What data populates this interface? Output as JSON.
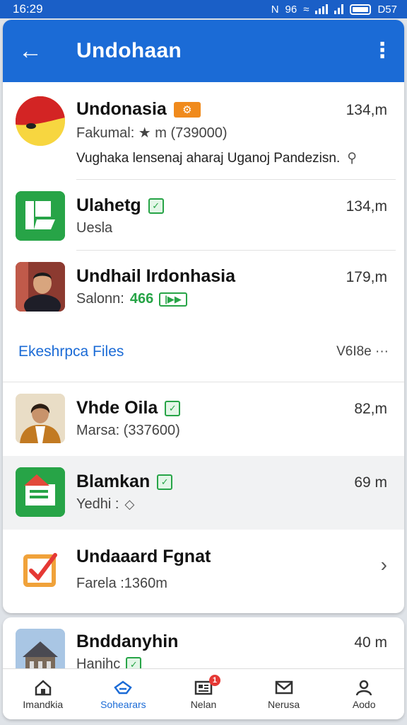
{
  "status_bar": {
    "time": "16:29",
    "network": "96",
    "battery": "D57"
  },
  "app_bar": {
    "title": "Undohaan",
    "back_icon": "arrow-left-icon",
    "menu_icon": "more-vert-icon"
  },
  "chats": [
    {
      "name": "Undonasia",
      "time": "134,m",
      "subtitle": "Fakumal: ★ m (739000)",
      "message": "Vughaka lensenaj aharaj Uganoj Pandezisn."
    },
    {
      "name": "Ulahetg",
      "time": "134,m",
      "subtitle": "Uesla"
    },
    {
      "name": "Undhail Irdonhasia",
      "time": "179,m",
      "subtitle": "Salonn:",
      "highlight": "466"
    }
  ],
  "section": {
    "title": "Ekeshrpca Files",
    "action": "V6I8e ···"
  },
  "files": [
    {
      "name": "Vhde Oila",
      "time": "82,m",
      "subtitle": "Marsa: (337600)"
    },
    {
      "name": "Blamkan",
      "time": "69 m",
      "subtitle": "Yedhi :"
    },
    {
      "name": "Undaaard Fgnat",
      "subtitle": "Farela :1360m"
    }
  ],
  "bottom_item": {
    "name": "Bnddanyhin",
    "time": "40 m",
    "subtitle": "Hanihc"
  },
  "bottom_nav": [
    {
      "label": "Imandkia",
      "icon": "home-icon"
    },
    {
      "label": "Sohearars",
      "icon": "folder-icon"
    },
    {
      "label": "Nelan",
      "icon": "newspaper-icon",
      "badge": "1"
    },
    {
      "label": "Nerusa",
      "icon": "mail-icon"
    },
    {
      "label": "Aodo",
      "icon": "person-icon"
    }
  ],
  "colors": {
    "primary": "#1b6bd6",
    "status": "#1a5fc7",
    "green": "#27a447",
    "orange": "#f08a1c",
    "red": "#e53935"
  }
}
